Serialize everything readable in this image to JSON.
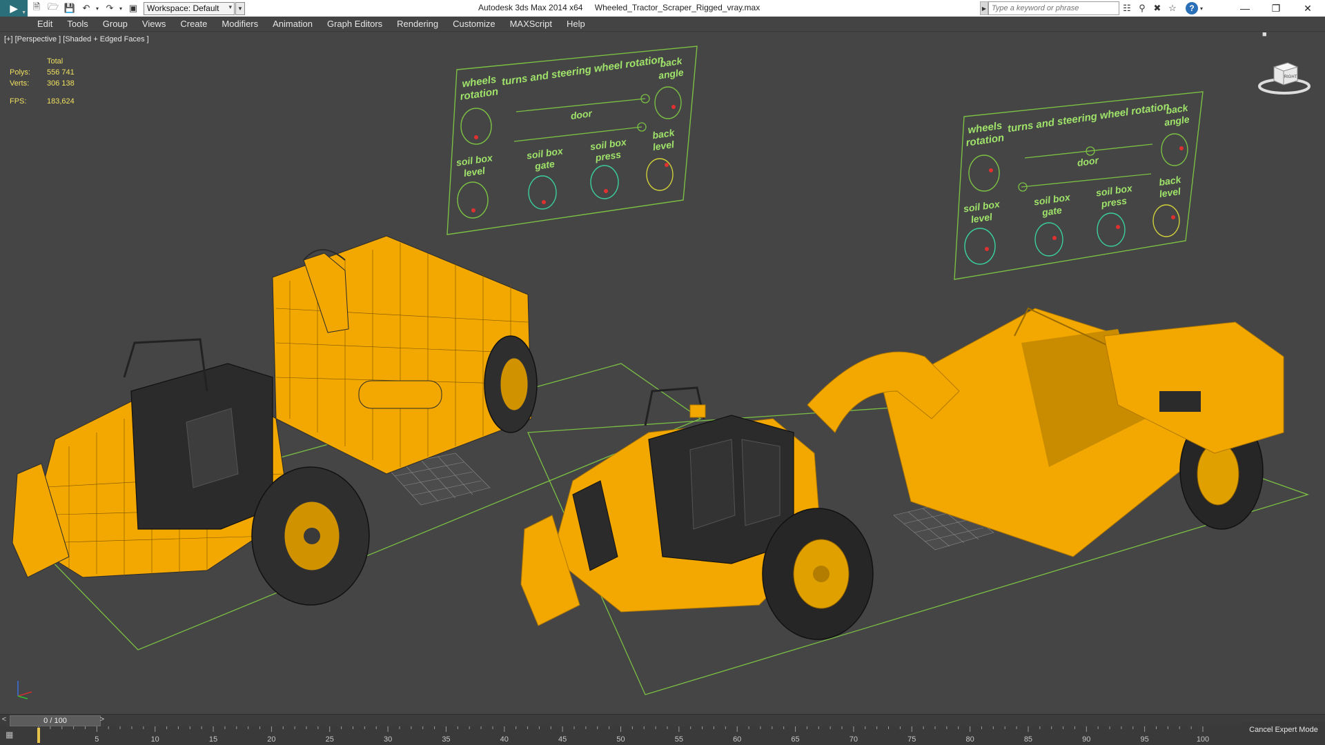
{
  "window": {
    "app_title": "Autodesk 3ds Max  2014 x64",
    "file_name": "Wheeled_Tractor_Scraper_Rigged_vray.max"
  },
  "toolbar": {
    "logo_icon": "3ds-max-logo-icon",
    "quick_access": [
      "new-file-icon",
      "open-file-icon",
      "save-icon",
      "undo-icon",
      "redo-icon",
      "project-folder-icon"
    ],
    "workspace_label": "Workspace: Default"
  },
  "search": {
    "placeholder": "Type a keyword or phrase",
    "tool_icons": [
      "binoculars-icon",
      "communication-center-icon",
      "favorites-icon",
      "star-icon",
      "help-icon"
    ]
  },
  "window_controls": [
    "minimize-icon",
    "restore-icon",
    "close-icon"
  ],
  "menu": [
    {
      "label": "Edit"
    },
    {
      "label": "Tools"
    },
    {
      "label": "Group"
    },
    {
      "label": "Views"
    },
    {
      "label": "Create"
    },
    {
      "label": "Modifiers"
    },
    {
      "label": "Animation"
    },
    {
      "label": "Graph Editors"
    },
    {
      "label": "Rendering"
    },
    {
      "label": "Customize"
    },
    {
      "label": "MAXScript"
    },
    {
      "label": "Help"
    }
  ],
  "viewport": {
    "label": "[+] [Perspective ] [Shaded + Edged Faces ]",
    "stats": {
      "header": "Total",
      "polys_label": "Polys:",
      "polys_value": "556 741",
      "verts_label": "Verts:",
      "verts_value": "306 138",
      "fps_label": "FPS:",
      "fps_value": "183,624"
    },
    "viewcube_label": "RIGHT"
  },
  "control_panels": [
    {
      "wheels": "wheels",
      "rotation": "rotation",
      "turns": "turns and steering wheel rotation",
      "back": "back",
      "angle": "angle",
      "door": "door",
      "soil_box_level_1": "soil box",
      "soil_box_level_2": "level",
      "soil_box_gate_1": "soil box",
      "soil_box_gate_2": "gate",
      "soil_box_press_1": "soil box",
      "soil_box_press_2": "press",
      "back_level_1": "back",
      "back_level_2": "level"
    },
    {
      "wheels": "wheels",
      "rotation": "rotation",
      "turns": "turns and steering wheel rotation",
      "back": "back",
      "angle": "angle",
      "door": "door",
      "soil_box_level_1": "soil box",
      "soil_box_level_2": "level",
      "soil_box_gate_1": "soil box",
      "soil_box_gate_2": "gate",
      "soil_box_press_1": "soil box",
      "soil_box_press_2": "press",
      "back_level_1": "back",
      "back_level_2": "level"
    }
  ],
  "timeline": {
    "frame_display": "0 / 100",
    "prev": "<",
    "next": ">",
    "ticks": [
      "0",
      "5",
      "10",
      "15",
      "20",
      "25",
      "30",
      "35",
      "40",
      "45",
      "50",
      "55",
      "60",
      "65",
      "70",
      "75",
      "80",
      "85",
      "90",
      "95",
      "100"
    ]
  },
  "status": {
    "cancel_expert": "Cancel Expert Mode"
  },
  "colors": {
    "viewport_bg": "#454545",
    "model_yellow": "#f2a800",
    "panel_green": "#9fe36a",
    "grid_green": "#7bc043",
    "stats_yellow": "#f0e060"
  }
}
